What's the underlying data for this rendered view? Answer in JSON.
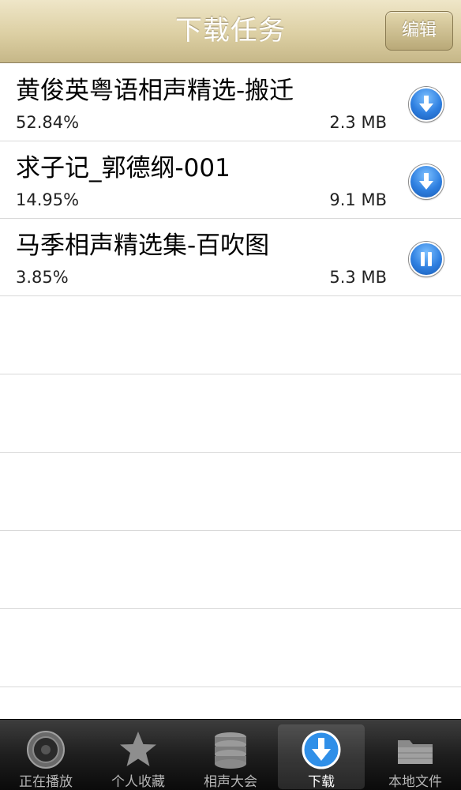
{
  "nav": {
    "title": "下载任务",
    "edit_label": "编辑"
  },
  "downloads": [
    {
      "title": "黄俊英粤语相声精选-搬迁",
      "progress": "52.84%",
      "size": "2.3 MB",
      "action_icon": "download-arrow-icon"
    },
    {
      "title": "求子记_郭德纲-001",
      "progress": "14.95%",
      "size": "9.1 MB",
      "action_icon": "download-arrow-icon"
    },
    {
      "title": "马季相声精选集-百吹图",
      "progress": "3.85%",
      "size": "5.3 MB",
      "action_icon": "pause-icon"
    }
  ],
  "tabs": [
    {
      "label": "正在播放",
      "icon": "speaker-icon",
      "active": false
    },
    {
      "label": "个人收藏",
      "icon": "star-icon",
      "active": false
    },
    {
      "label": "相声大会",
      "icon": "database-icon",
      "active": false
    },
    {
      "label": "下载",
      "icon": "download-icon",
      "active": true
    },
    {
      "label": "本地文件",
      "icon": "folder-icon",
      "active": false
    }
  ],
  "colors": {
    "nav_bar": "#dccfa3",
    "action_button": "#2e7fe0",
    "tab_bar": "#1e1e1e"
  }
}
